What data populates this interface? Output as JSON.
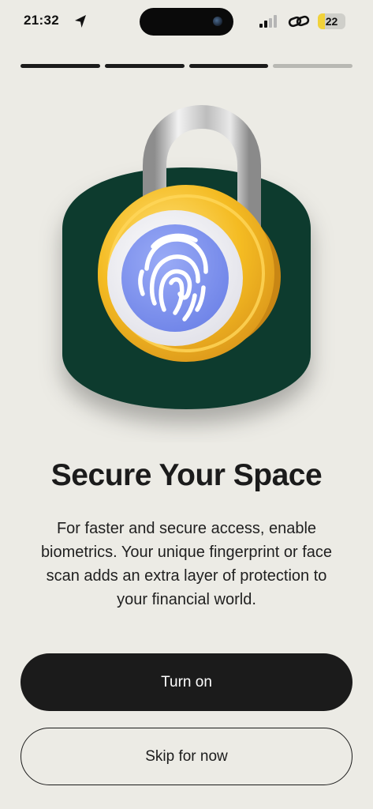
{
  "status_bar": {
    "time": "21:32",
    "battery_level": "22",
    "icons": [
      "location-arrow-icon",
      "signal-icon",
      "link-icon",
      "battery-icon"
    ]
  },
  "progress": {
    "total_steps": 4,
    "current_step": 3
  },
  "illustration": {
    "icon": "padlock-fingerprint-icon",
    "colors": {
      "background_shape": "#0d3b2e",
      "lock_body": "#f2b928",
      "shackle": "#c9c9c9",
      "fingerprint_disc": "#7f93ef"
    }
  },
  "content": {
    "title": "Secure Your Space",
    "description": "For faster and secure access, enable biometrics. Your unique fingerprint or face scan adds an extra layer of protection to your financial world."
  },
  "actions": {
    "primary_label": "Turn on",
    "secondary_label": "Skip for now"
  },
  "colors": {
    "background": "#ecebe5",
    "primary_button": "#1b1b1b",
    "text": "#1b1b1b"
  }
}
